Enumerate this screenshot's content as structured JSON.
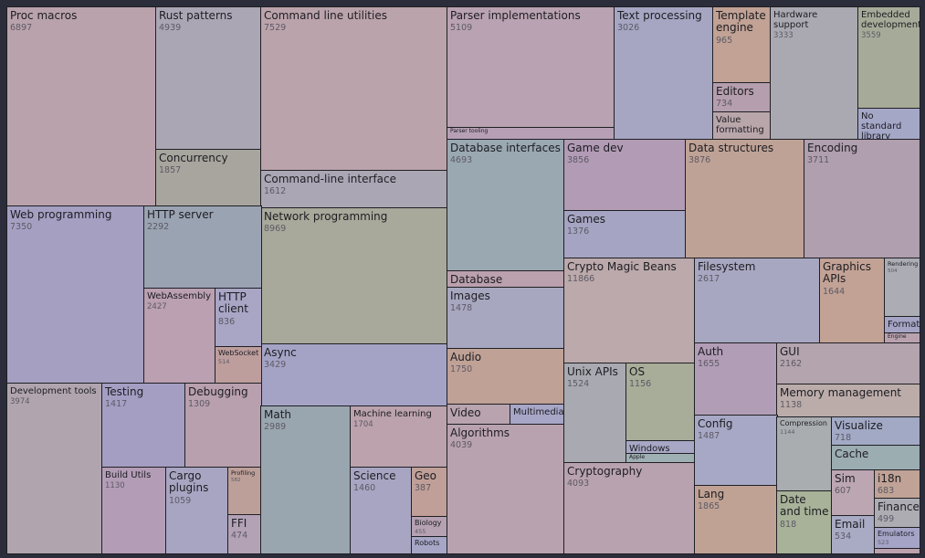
{
  "chart_data": {
    "type": "treemap",
    "title": "",
    "items": [
      {
        "name": "Proc macros",
        "value": 6897,
        "color": "#b9a2ab"
      },
      {
        "name": "Rust patterns",
        "value": 4939,
        "color": "#aba6b4"
      },
      {
        "name": "Concurrency",
        "value": 1857,
        "color": "#a7a59d"
      },
      {
        "name": "Command line utilities",
        "value": 7529,
        "color": "#bba3ab"
      },
      {
        "name": "Command-line interface",
        "value": 1612,
        "color": "#aba6b4"
      },
      {
        "name": "Network programming",
        "value": 8969,
        "color": "#a8a99b"
      },
      {
        "name": "Async",
        "value": 3429,
        "color": "#a5a3c5"
      },
      {
        "name": "Web programming",
        "value": 7350,
        "color": "#a59fc2"
      },
      {
        "name": "HTTP server",
        "value": 2292,
        "color": "#9aa3b2"
      },
      {
        "name": "WebAssembly",
        "value": 2427,
        "color": "#baa0b1"
      },
      {
        "name": "HTTP client",
        "value": 836,
        "color": "#a8a5c5"
      },
      {
        "name": "WebSocket",
        "value": 514,
        "color": "#bd9e9d"
      },
      {
        "name": "Development tools",
        "value": 3974,
        "color": "#b0a5ae"
      },
      {
        "name": "Testing",
        "value": 1417,
        "color": "#a59ec3"
      },
      {
        "name": "Debugging",
        "value": 1309,
        "color": "#b9a0ae"
      },
      {
        "name": "Build Utils",
        "value": 1130,
        "color": "#b39db6"
      },
      {
        "name": "Cargo plugins",
        "value": 1059,
        "color": "#a8a5c2"
      },
      {
        "name": "Profiling",
        "value": 582,
        "color": "#bc9f98"
      },
      {
        "name": "FFI",
        "value": 474,
        "color": "#b3a2b6"
      },
      {
        "name": "Math",
        "value": 2989,
        "color": "#9aa6af"
      },
      {
        "name": "Machine learning",
        "value": 1704,
        "color": "#bba2ac"
      },
      {
        "name": "Science",
        "value": 1460,
        "color": "#a8a5c2"
      },
      {
        "name": "Geo",
        "value": 387,
        "color": "#bf9f98"
      },
      {
        "name": "Biology",
        "value": 455,
        "color": "#b5a1b2"
      },
      {
        "name": "Robots",
        "value": null,
        "color": "#a7a6c7"
      },
      {
        "name": "Parser implementations",
        "value": 5109,
        "color": "#b9a2b1"
      },
      {
        "name": "Parser tooling",
        "value": null,
        "color": "#b7a0b6"
      },
      {
        "name": "Text processing",
        "value": 3026,
        "color": "#a6a6c3"
      },
      {
        "name": "Template engine",
        "value": 965,
        "color": "#c1a295"
      },
      {
        "name": "Editors",
        "value": 734,
        "color": "#b59ead"
      },
      {
        "name": "Value formatting",
        "value": null,
        "color": "#b9a6ab"
      },
      {
        "name": "Hardware support",
        "value": 3333,
        "color": "#aaa9b1"
      },
      {
        "name": "Embedded development",
        "value": 3559,
        "color": "#a6ab99"
      },
      {
        "name": "No standard library",
        "value": null,
        "color": "#a5a7c7"
      },
      {
        "name": "Database interfaces",
        "value": 4693,
        "color": "#9aa8b2"
      },
      {
        "name": "Database",
        "value": null,
        "color": "#bba0ad"
      },
      {
        "name": "Images",
        "value": 1478,
        "color": "#a8a7c0"
      },
      {
        "name": "Audio",
        "value": 1750,
        "color": "#bfa196"
      },
      {
        "name": "Video",
        "value": null,
        "color": "#b8a3ae"
      },
      {
        "name": "Multimedia",
        "value": null,
        "color": "#a7a6c7"
      },
      {
        "name": "Algorithms",
        "value": 4039,
        "color": "#b9a2af"
      },
      {
        "name": "Game dev",
        "value": 3856,
        "color": "#b29bb5"
      },
      {
        "name": "Games",
        "value": 1376,
        "color": "#a5a4c2"
      },
      {
        "name": "Data structures",
        "value": 3876,
        "color": "#bfa296"
      },
      {
        "name": "Encoding",
        "value": 3711,
        "color": "#b09fae"
      },
      {
        "name": "Crypto Magic Beans",
        "value": 11866,
        "color": "#bba9ab"
      },
      {
        "name": "Unix APIs",
        "value": 1524,
        "color": "#a9aab1"
      },
      {
        "name": "OS",
        "value": 1156,
        "color": "#a7ad98"
      },
      {
        "name": "Windows APIs",
        "value": null,
        "color": "#a8a8c6"
      },
      {
        "name": "Apple",
        "value": null,
        "color": "#9fb0b4"
      },
      {
        "name": "Cryptography",
        "value": 4093,
        "color": "#b9a2af"
      },
      {
        "name": "Filesystem",
        "value": 2617,
        "color": "#a8a7c1"
      },
      {
        "name": "Graphics APIs",
        "value": 1644,
        "color": "#c2a295"
      },
      {
        "name": "Rendering",
        "value": 504,
        "color": "#acacb4"
      },
      {
        "name": "Formats",
        "value": null,
        "color": "#a5a4c5"
      },
      {
        "name": "Engine",
        "value": null,
        "color": "#b9a2ae"
      },
      {
        "name": "Auth",
        "value": 1655,
        "color": "#b29db6"
      },
      {
        "name": "GUI",
        "value": 2162,
        "color": "#b3a4ae"
      },
      {
        "name": "Memory management",
        "value": 1138,
        "color": "#bbacaa"
      },
      {
        "name": "Config",
        "value": 1487,
        "color": "#a7a8c5"
      },
      {
        "name": "Lang",
        "value": 1865,
        "color": "#c0a294"
      },
      {
        "name": "Compression",
        "value": 1144,
        "color": "#a9adb0"
      },
      {
        "name": "Date and time",
        "value": 818,
        "color": "#a7b298"
      },
      {
        "name": "Visualize",
        "value": 718,
        "color": "#a2a9c5"
      },
      {
        "name": "Cache",
        "value": null,
        "color": "#9cadb2"
      },
      {
        "name": "Sim",
        "value": 607,
        "color": "#bba6b2"
      },
      {
        "name": "Email",
        "value": 534,
        "color": "#a9aac3"
      },
      {
        "name": "i18n",
        "value": 683,
        "color": "#c0a396"
      },
      {
        "name": "Finance",
        "value": 499,
        "color": "#adacb3"
      },
      {
        "name": "Emulators",
        "value": 523,
        "color": "#a5a4c7"
      },
      {
        "name": "",
        "value": null,
        "color": "#bba2ad"
      }
    ]
  }
}
